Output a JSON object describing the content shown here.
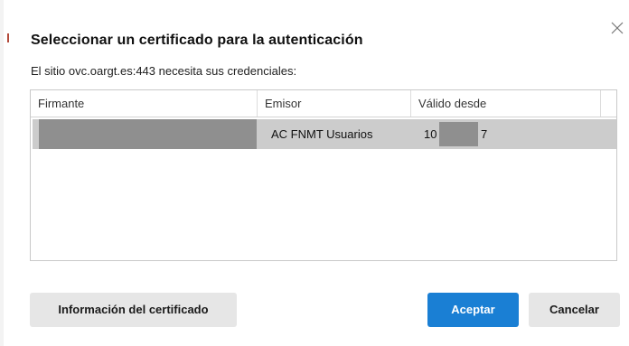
{
  "dialog": {
    "title": "Seleccionar un certificado para la autenticación",
    "subtitle": "El sitio ovc.oargt.es:443 necesita sus credenciales:",
    "close_icon": "close-icon"
  },
  "table": {
    "columns": [
      "Firmante",
      "Emisor",
      "Válido desde"
    ],
    "rows": [
      {
        "firmante": "",
        "emisor": "AC FNMT Usuarios",
        "valido_desde_start": "10",
        "valido_desde_end": "7",
        "selected": true
      }
    ]
  },
  "buttons": {
    "info_label": "Información del certificado",
    "accept_label": "Aceptar",
    "cancel_label": "Cancelar"
  },
  "colors": {
    "accent": "#1a7fd4",
    "selected_row": "#cccccc",
    "redaction": "#8f8f8f",
    "secondary_button": "#e6e6e6"
  }
}
